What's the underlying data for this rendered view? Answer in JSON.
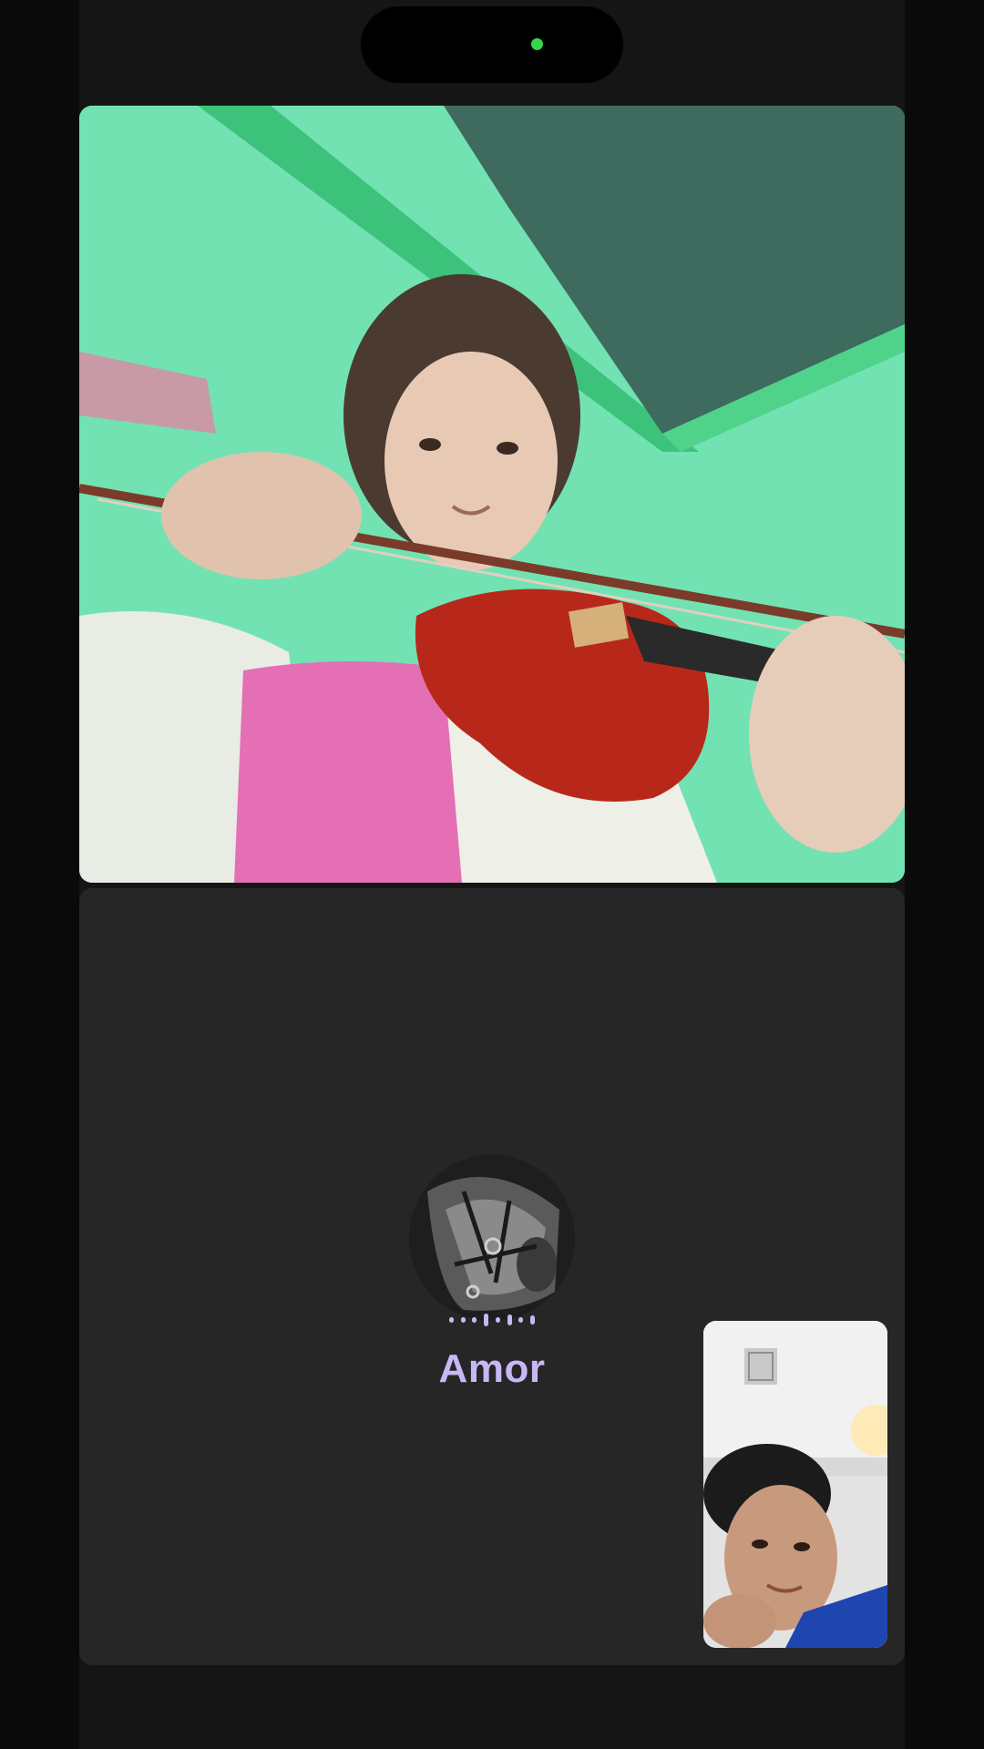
{
  "call": {
    "participant_name": "Amor",
    "camera_indicator_color": "#33d74b",
    "name_color": "#c7b8f5"
  },
  "remote_video": {
    "icon": "video-feed"
  },
  "participant_tile": {
    "avatar_icon": "avatar-horse-photo",
    "speaking_indicator_icon": "audio-waveform-icon"
  },
  "self_view": {
    "icon": "self-camera-preview"
  }
}
